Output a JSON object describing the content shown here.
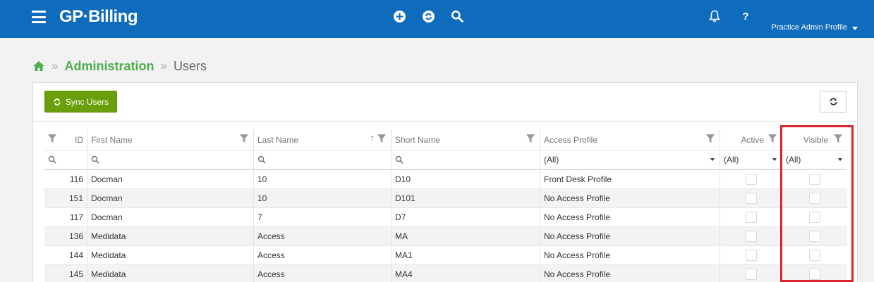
{
  "app": {
    "brand": "GP·Billing",
    "profile": "Practice Admin Profile",
    "brand_color": "#0f6cbd"
  },
  "breadcrumb": {
    "sep": "»",
    "section": "Administration",
    "current": "Users"
  },
  "toolbar": {
    "sync_label": "Sync Users",
    "accent": "#6a9e0a"
  },
  "columns": [
    "ID",
    "First Name",
    "Last Name",
    "Short Name",
    "Access Profile",
    "Active",
    "Visible"
  ],
  "filters": {
    "access_profile": "(All)",
    "active": "(All)",
    "visible": "(All)"
  },
  "rows": [
    {
      "id": "116",
      "first": "Docman",
      "last": "10",
      "short": "D10",
      "profile": "Front Desk Profile",
      "active": false,
      "visible": false
    },
    {
      "id": "151",
      "first": "Docman",
      "last": "10",
      "short": "D101",
      "profile": "No Access Profile",
      "active": false,
      "visible": false
    },
    {
      "id": "117",
      "first": "Docman",
      "last": "7",
      "short": "D7",
      "profile": "No Access Profile",
      "active": false,
      "visible": false
    },
    {
      "id": "136",
      "first": "Medidata",
      "last": "Access",
      "short": "MA",
      "profile": "No Access Profile",
      "active": false,
      "visible": false
    },
    {
      "id": "144",
      "first": "Medidata",
      "last": "Access",
      "short": "MA1",
      "profile": "No Access Profile",
      "active": false,
      "visible": false
    },
    {
      "id": "145",
      "first": "Medidata",
      "last": "Access",
      "short": "MA4",
      "profile": "No Access Profile",
      "active": false,
      "visible": false
    }
  ],
  "icons": [
    "menu-icon",
    "plus-circle-icon",
    "sync-circle-icon",
    "search-icon",
    "bell-icon",
    "help-icon",
    "home-icon",
    "refresh-icon",
    "filter-icon",
    "sort-icon"
  ]
}
